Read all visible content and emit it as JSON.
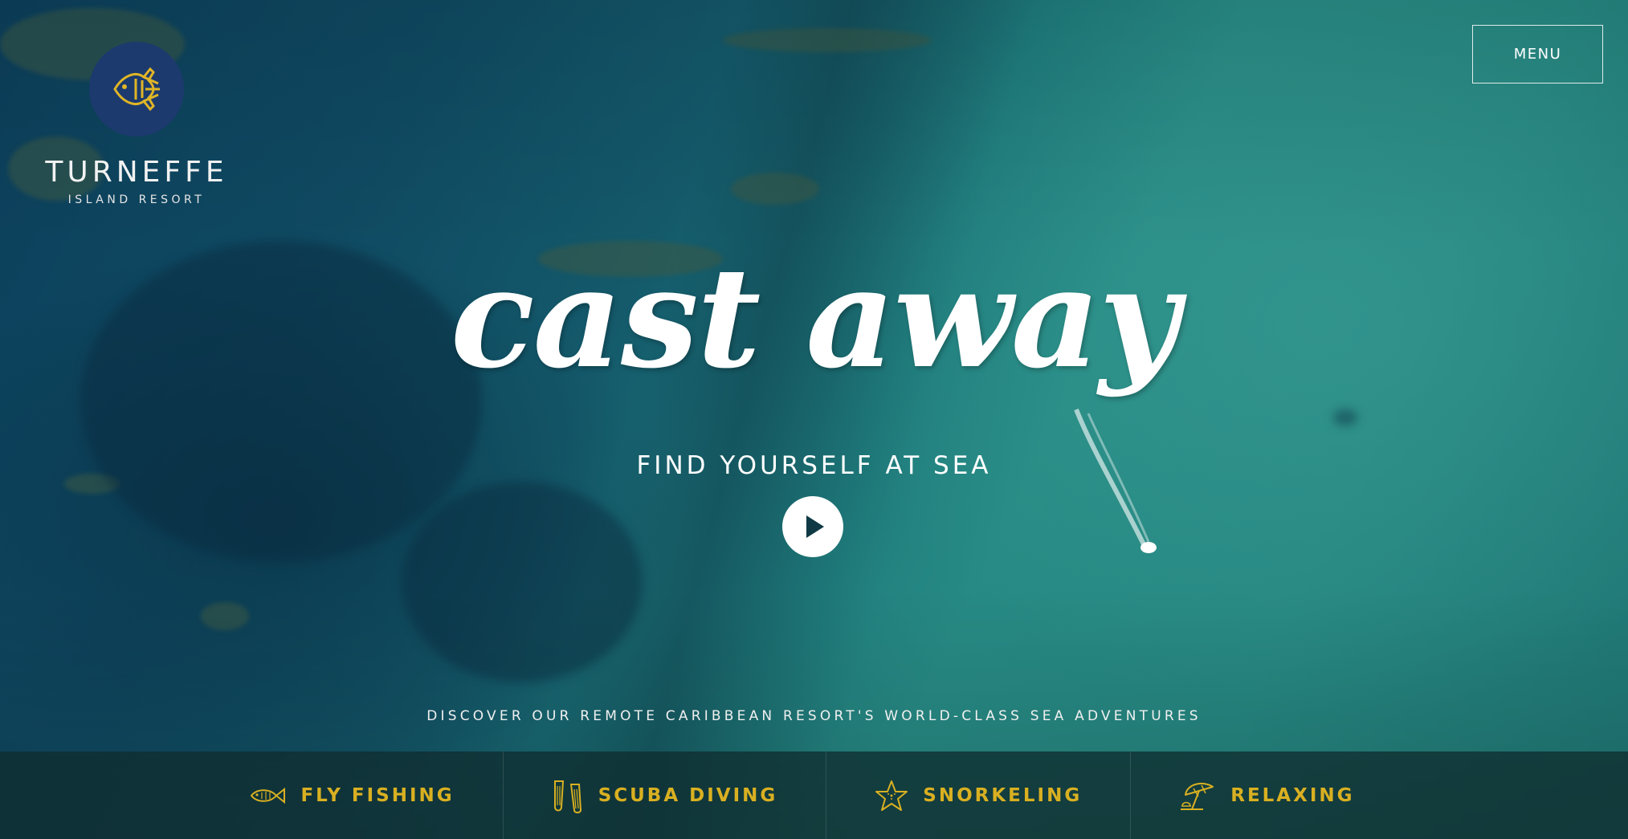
{
  "brand": {
    "name": "TURNEFFE",
    "subtitle": "ISLAND RESORT"
  },
  "header": {
    "menu_label": "MENU"
  },
  "hero": {
    "headline": "cast away",
    "subheadline": "FIND YOURSELF AT SEA",
    "tagline": "DISCOVER OUR REMOTE CARIBBEAN RESORT'S WORLD-CLASS SEA ADVENTURES",
    "play_icon": "play-icon"
  },
  "activities": [
    {
      "label": "FLY FISHING",
      "icon": "fish-icon"
    },
    {
      "label": "SCUBA DIVING",
      "icon": "flippers-icon"
    },
    {
      "label": "SNORKELING",
      "icon": "starfish-icon"
    },
    {
      "label": "RELAXING",
      "icon": "beach-umbrella-icon"
    }
  ],
  "colors": {
    "accent_gold": "#d9b021",
    "logo_navy": "#1c3a6e",
    "bar_background": "#0f2d30"
  }
}
